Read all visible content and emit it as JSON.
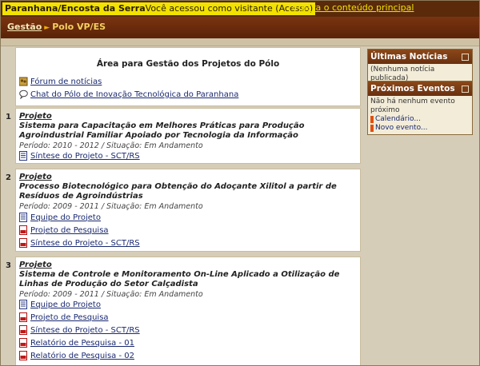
{
  "header": {
    "site_title": "Paranhana/Encosta da Serra",
    "visitor_text": "Você acessou como visitante (",
    "login_link": "Acesso",
    "visitor_close": ")",
    "skip_prefix": "Ir",
    "skip_link": "para o conteúdo principal"
  },
  "breadcrumb": {
    "root": "Gestão",
    "separator": "►",
    "current": "Polo VP/ES"
  },
  "main": {
    "area_title": "Área para Gestão dos Projetos do Pólo",
    "area_links": [
      {
        "label": "Fórum de notícias",
        "icon": "forum-icon"
      },
      {
        "label": "Chat do Pólo de Inovação Tecnológica do Paranhana",
        "icon": "chat-icon"
      }
    ],
    "projects": [
      {
        "number": "1",
        "label": "Projeto",
        "title": "Sistema para Capacitação em Melhores Práticas para Produção Agroindustrial Familiar Apoiado por Tecnologia da Informação",
        "period": "Período: 2010 - 2012 / Situação: Em Andamento",
        "links": [
          "Síntese do Projeto - SCT/RS"
        ]
      },
      {
        "number": "2",
        "label": "Projeto",
        "title": "Processo Biotecnológico para Obtenção do Adoçante Xilitol a partir de Resíduos de Agroindústrias",
        "period": "Período: 2009 - 2011 / Situação: Em Andamento",
        "links": [
          "Equipe do Projeto",
          "Projeto de Pesquisa",
          "Síntese do Projeto - SCT/RS"
        ]
      },
      {
        "number": "3",
        "label": "Projeto",
        "title": "Sistema de Controle e Monitoramento On-Line Aplicado a Otilização de Linhas de Produção do Setor Calçadista",
        "period": "Período: 2009 - 2011 / Situação: Em Andamento",
        "links": [
          "Equipe do Projeto",
          "Projeto de Pesquisa",
          "Síntese do Projeto - SCT/RS",
          "Relatório de Pesquisa - 01",
          "Relatório de Pesquisa - 02"
        ]
      }
    ]
  },
  "sidebar": {
    "news": {
      "title": "Últimas Notícias",
      "empty": "(Nenhuma notícia publicada)"
    },
    "events": {
      "title": "Próximos Eventos",
      "empty_line1": "Não há nenhum evento",
      "empty_line2": "próximo",
      "calendar_link": "Calendário...",
      "new_event_link": "Novo evento..."
    }
  },
  "colors": {
    "topbar": "#5a2a0a",
    "title_highlight": "#f2e200",
    "link": "#1a2a70",
    "sidebar_head": "#7a3c14"
  }
}
